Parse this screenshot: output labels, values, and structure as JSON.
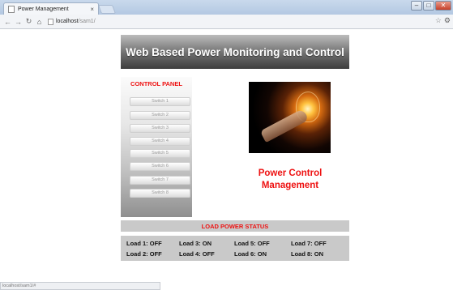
{
  "browser": {
    "tab_title": "Power Management",
    "tab_close": "×",
    "address_host": "localhost",
    "address_path": "/sam1/",
    "status_text": "localhost/sam1/#"
  },
  "header": {
    "title": "Web Based Power Monitoring and Control"
  },
  "control_panel": {
    "title": "CONTROL PANEL",
    "switches": [
      "Switch 1",
      "Switch 2",
      "Switch 3",
      "Switch 4",
      "Switch 5",
      "Switch 6",
      "Switch 7",
      "Switch 8"
    ]
  },
  "brand": {
    "line1": "Power Control",
    "line2": "Management"
  },
  "load_status": {
    "title": "LOAD POWER STATUS",
    "loads": [
      "Load 1: OFF",
      "Load 2: OFF",
      "Load 3: ON",
      "Load 4: OFF",
      "Load 5: OFF",
      "Load 6: ON",
      "Load 7: OFF",
      "Load 8: ON"
    ]
  },
  "icons": {
    "back": "back-arrow-icon",
    "forward": "forward-arrow-icon",
    "reload": "reload-icon",
    "home": "home-icon",
    "bookmark": "star-icon",
    "menu": "wrench-icon"
  }
}
